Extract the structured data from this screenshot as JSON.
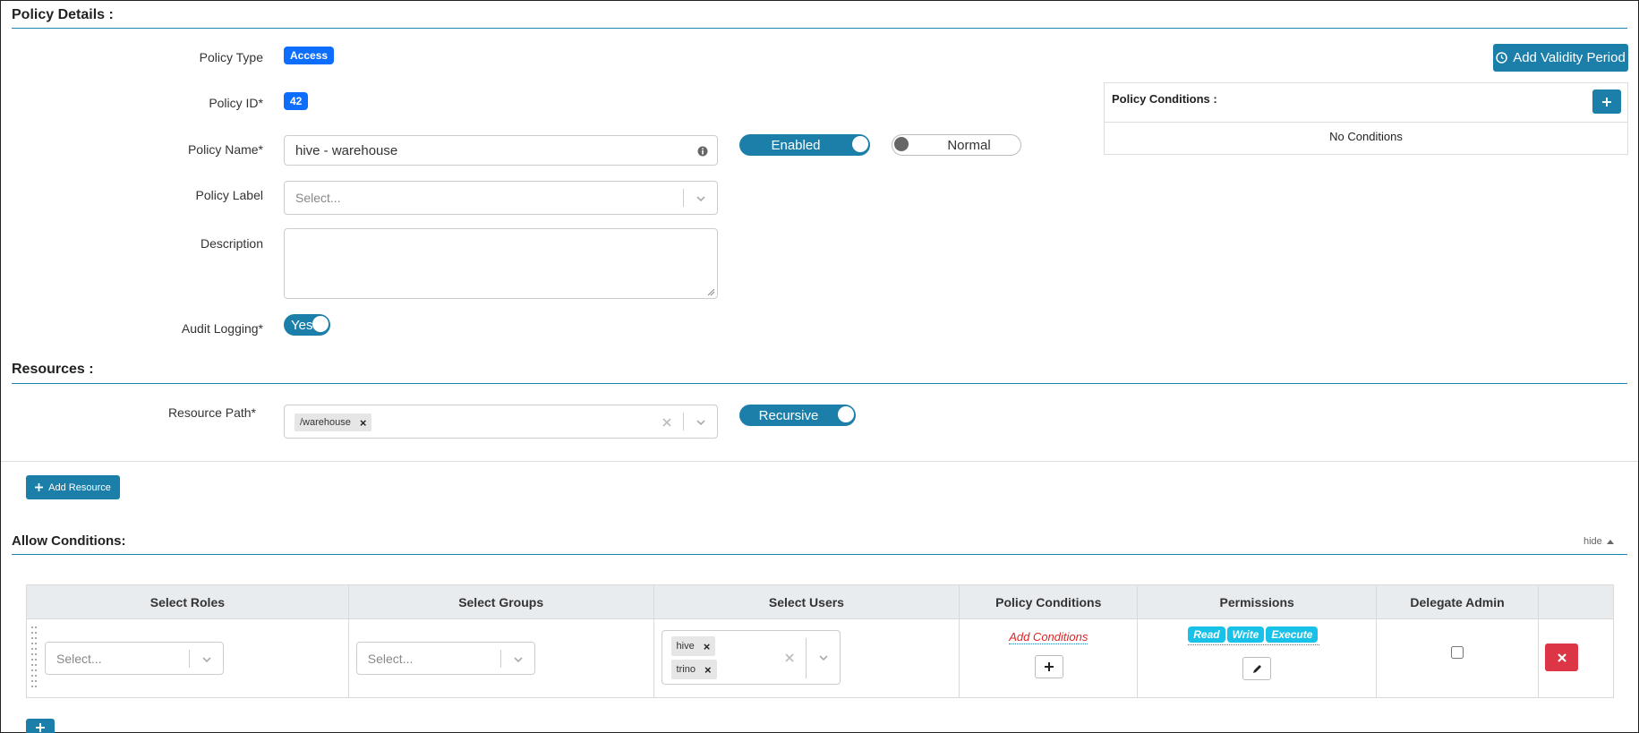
{
  "policy_details": {
    "title": "Policy Details :",
    "policy_type_label": "Policy Type",
    "policy_type_value": "Access",
    "policy_id_label": "Policy ID*",
    "policy_id_value": "42",
    "policy_name_label": "Policy Name*",
    "policy_name_value": "hive - warehouse",
    "enabled_toggle": "Enabled",
    "normal_toggle": "Normal",
    "policy_label_label": "Policy Label",
    "policy_label_placeholder": "Select...",
    "description_label": "Description",
    "description_value": "",
    "audit_logging_label": "Audit Logging*",
    "audit_logging_value": "Yes",
    "add_validity_period": "Add Validity Period",
    "policy_conditions_title": "Policy Conditions :",
    "no_conditions": "No Conditions"
  },
  "resources": {
    "title": "Resources :",
    "resource_path_label": "Resource Path*",
    "resource_path_values": [
      "/warehouse"
    ],
    "recursive_toggle": "Recursive",
    "add_resource": "Add Resource"
  },
  "allow_conditions": {
    "title": "Allow Conditions:",
    "hide_link": "hide",
    "columns": [
      "Select Roles",
      "Select Groups",
      "Select Users",
      "Policy Conditions",
      "Permissions",
      "Delegate Admin"
    ],
    "row": {
      "roles_placeholder": "Select...",
      "groups_placeholder": "Select...",
      "users": [
        "hive",
        "trino"
      ],
      "add_conditions": "Add Conditions",
      "permissions": [
        "Read",
        "Write",
        "Execute"
      ],
      "delegate_admin": false
    }
  },
  "colors": {
    "accent": "#1b7fa9",
    "badge": "#0d6efd",
    "danger": "#dc3545",
    "perm": "#17c1e8"
  },
  "icons": {
    "info": "info-circle-icon",
    "clock": "clock-icon",
    "plus": "plus-icon",
    "pencil": "pencil-icon",
    "times": "times-icon",
    "chevron": "chevron-down-icon"
  }
}
